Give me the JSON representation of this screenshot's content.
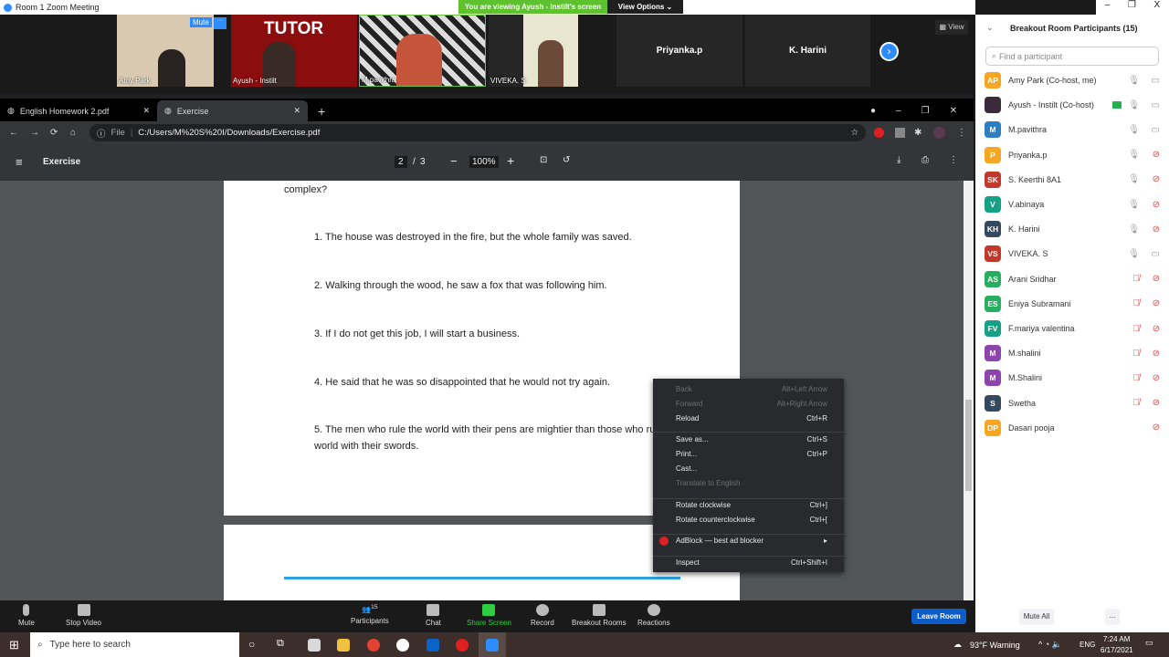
{
  "titlebar": {
    "title": "Room 1  Zoom Meeting",
    "banner": "You are viewing Ayush - Instilt's screen",
    "view_options": "View Options ⌄",
    "controls": [
      "–",
      "❐",
      "X"
    ]
  },
  "strip": {
    "tiles": [
      {
        "name": "Amy Park",
        "mute": "Mute",
        "more": "···"
      },
      {
        "name": "Ayush - Instilt",
        "overlay": "TUTOR"
      },
      {
        "name": "M.pavithra"
      },
      {
        "name": "VIVEKA. S"
      },
      {
        "name": "Priyanka.p"
      },
      {
        "name": "K. Harini"
      }
    ],
    "view_label": "View"
  },
  "browser": {
    "tabs": [
      {
        "title": "English Homework 2.pdf"
      },
      {
        "title": "Exercise"
      }
    ],
    "url_scheme": "File",
    "url": "C:/Users/M%20S%20I/Downloads/Exercise.pdf"
  },
  "pdf": {
    "title": "Exercise",
    "page_current": "2",
    "page_total": "3",
    "zoom": "100%",
    "fragment": "complex?",
    "questions": [
      "1. The house was destroyed in the fire, but the whole family was saved.",
      "2. Walking through the wood, he saw a fox that was following him.",
      "3. If I do not get this job, I will start a business.",
      "4. He said that he was so disappointed that he would not try again.",
      "5. The men who rule the world with their pens are mightier than those who rule the world with their swords."
    ]
  },
  "context_menu": {
    "items": [
      {
        "label": "Back",
        "shortcut": "Alt+Left Arrow",
        "disabled": true
      },
      {
        "label": "Forward",
        "shortcut": "Alt+Right Arrow",
        "disabled": true
      },
      {
        "label": "Reload",
        "shortcut": "Ctrl+R"
      },
      {
        "label": "Save as...",
        "shortcut": "Ctrl+S"
      },
      {
        "label": "Print...",
        "shortcut": "Ctrl+P"
      },
      {
        "label": "Cast...",
        "shortcut": ""
      },
      {
        "label": "Translate to English",
        "shortcut": "",
        "disabled": true
      },
      {
        "label": "Rotate clockwise",
        "shortcut": "Ctrl+]"
      },
      {
        "label": "Rotate counterclockwise",
        "shortcut": "Ctrl+["
      },
      {
        "label": "AdBlock — best ad blocker",
        "shortcut": "▸"
      },
      {
        "label": "Inspect",
        "shortcut": "Ctrl+Shift+I"
      }
    ]
  },
  "toolbar": {
    "mute": "Mute",
    "stop_video": "Stop Video",
    "participants": "Participants",
    "participants_count": "15",
    "chat": "Chat",
    "share_screen": "Share Screen",
    "record": "Record",
    "breakout": "Breakout Rooms",
    "reactions": "Reactions",
    "leave": "Leave Room"
  },
  "panel": {
    "title": "Breakout Room Participants (15)",
    "search_placeholder": "Find a participant",
    "mute_all": "Mute All",
    "more": "...",
    "participants": [
      {
        "initials": "AP",
        "name": "Amy Park (Co-host, me)",
        "color": "#f5a623",
        "mic": "on",
        "video": "on"
      },
      {
        "initials": "",
        "name": "Ayush - Instilt (Co-host)",
        "color": "#3a2a3a",
        "mic": "on",
        "video": "on",
        "sharing": true
      },
      {
        "initials": "M",
        "name": "M.pavithra",
        "color": "#2d7fc1",
        "mic": "on",
        "video": "on"
      },
      {
        "initials": "P",
        "name": "Priyanka.p",
        "color": "#f5a623",
        "mic": "on",
        "video": "off"
      },
      {
        "initials": "SK",
        "name": "S. Keerthi 8A1",
        "color": "#c0392b",
        "mic": "on",
        "video": "off"
      },
      {
        "initials": "V",
        "name": "V.abinaya",
        "color": "#16a085",
        "mic": "on",
        "video": "off"
      },
      {
        "initials": "KH",
        "name": "K. Harini",
        "color": "#34495e",
        "mic": "on",
        "video": "off"
      },
      {
        "initials": "VS",
        "name": "VIVEKA. S",
        "color": "#c0392b",
        "mic": "on",
        "video": "on"
      },
      {
        "initials": "AS",
        "name": "Arani Sridhar",
        "color": "#27ae60",
        "mic": "off",
        "video": "off"
      },
      {
        "initials": "ES",
        "name": "Eniya Subramani",
        "color": "#27ae60",
        "mic": "off",
        "video": "off"
      },
      {
        "initials": "FV",
        "name": "F.mariya valentina",
        "color": "#16a085",
        "mic": "off",
        "video": "off"
      },
      {
        "initials": "M",
        "name": "M.shalini",
        "color": "#8e44ad",
        "mic": "off",
        "video": "off"
      },
      {
        "initials": "M",
        "name": "M.Shalini",
        "color": "#8e44ad",
        "mic": "off",
        "video": "off"
      },
      {
        "initials": "S",
        "name": "Swetha",
        "color": "#34495e",
        "mic": "off",
        "video": "off"
      },
      {
        "initials": "DP",
        "name": "Dasari pooja",
        "color": "#f5a623",
        "mic": "none",
        "video": "off"
      }
    ]
  },
  "taskbar": {
    "search_placeholder": "Type here to search",
    "weather": "93°F  Warning",
    "lang": "ENG",
    "time": "7:24 AM",
    "date": "6/17/2021"
  }
}
